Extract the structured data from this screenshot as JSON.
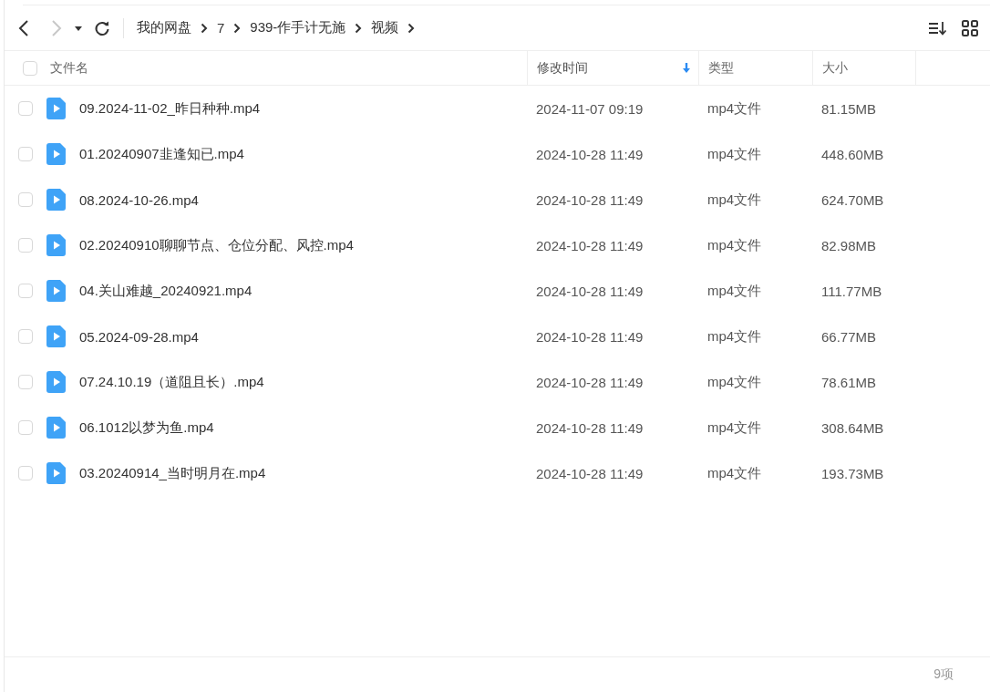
{
  "toolbar": {
    "back_disabled": false,
    "forward_disabled": true
  },
  "breadcrumb": [
    "我的网盘",
    "7",
    "939-作手计无施",
    "视频"
  ],
  "table": {
    "select_all": false,
    "columns": [
      {
        "label": "文件名",
        "sorted": false
      },
      {
        "label": "修改时间",
        "sorted": true
      },
      {
        "label": "类型",
        "sorted": false
      },
      {
        "label": "大小",
        "sorted": false
      }
    ],
    "rows": [
      {
        "name": "09.2024-11-02_昨日种种.mp4",
        "modified": "2024-11-07 09:19",
        "type": "mp4文件",
        "size": "81.15MB",
        "selected": false
      },
      {
        "name": "01.20240907韭逢知已.mp4",
        "modified": "2024-10-28 11:49",
        "type": "mp4文件",
        "size": "448.60MB",
        "selected": false
      },
      {
        "name": "08.2024-10-26.mp4",
        "modified": "2024-10-28 11:49",
        "type": "mp4文件",
        "size": "624.70MB",
        "selected": false
      },
      {
        "name": "02.20240910聊聊节点、仓位分配、风控.mp4",
        "modified": "2024-10-28 11:49",
        "type": "mp4文件",
        "size": "82.98MB",
        "selected": false
      },
      {
        "name": "04.关山难越_20240921.mp4",
        "modified": "2024-10-28 11:49",
        "type": "mp4文件",
        "size": "111.77MB",
        "selected": false
      },
      {
        "name": "05.2024-09-28.mp4",
        "modified": "2024-10-28 11:49",
        "type": "mp4文件",
        "size": "66.77MB",
        "selected": false
      },
      {
        "name": "07.24.10.19（道阻且长）.mp4",
        "modified": "2024-10-28 11:49",
        "type": "mp4文件",
        "size": "78.61MB",
        "selected": false
      },
      {
        "name": "06.1012以梦为鱼.mp4",
        "modified": "2024-10-28 11:49",
        "type": "mp4文件",
        "size": "308.64MB",
        "selected": false
      },
      {
        "name": "03.20240914_当时明月在.mp4",
        "modified": "2024-10-28 11:49",
        "type": "mp4文件",
        "size": "193.73MB",
        "selected": false
      }
    ]
  },
  "footer": {
    "count": "9项"
  }
}
